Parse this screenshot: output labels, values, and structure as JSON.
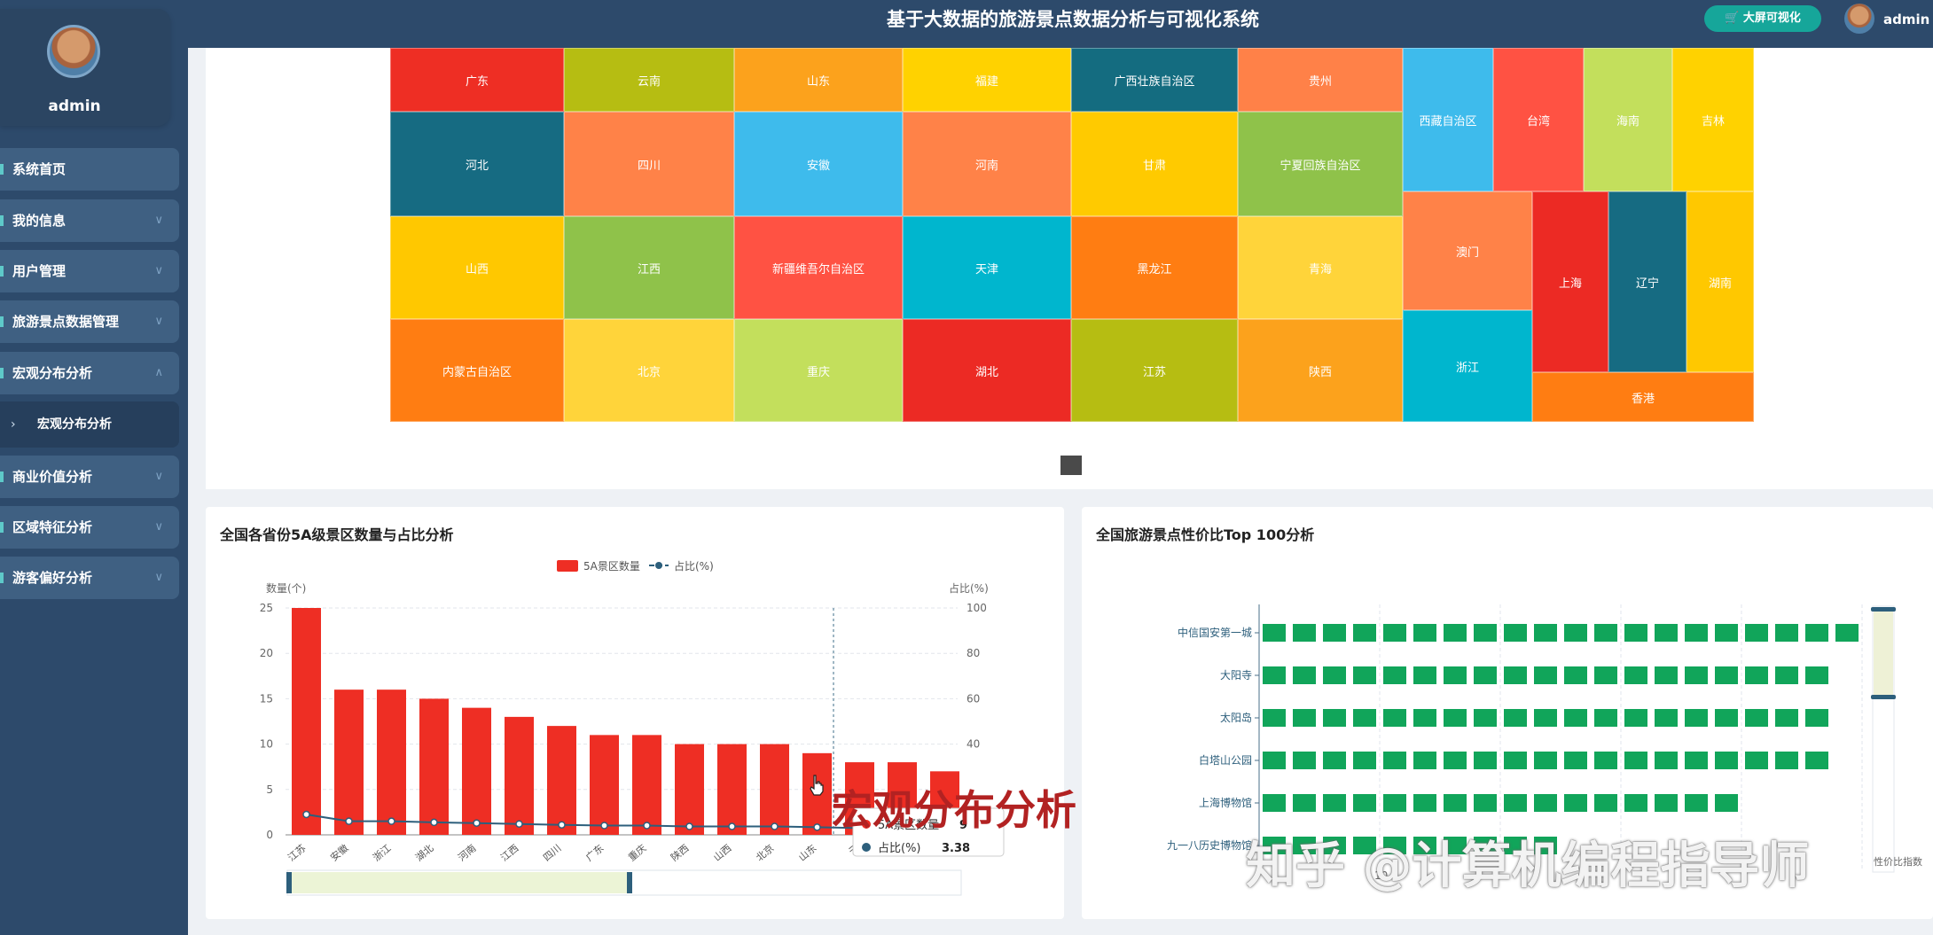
{
  "header": {
    "title": "基于大数据的旅游景点数据分析与可视化系统",
    "big_screen_label": "大屏可视化",
    "user": "admin"
  },
  "sidebar": {
    "user": "admin",
    "items": [
      {
        "label": "系统首页"
      },
      {
        "label": "我的信息",
        "chevron": "∨"
      },
      {
        "label": "用户管理",
        "chevron": "∨"
      },
      {
        "label": "旅游景点数据管理",
        "chevron": "∨"
      },
      {
        "label": "宏观分布分析",
        "chevron": "∧"
      },
      {
        "label": "商业价值分析",
        "chevron": "∨"
      },
      {
        "label": "区域特征分析",
        "chevron": "∨"
      },
      {
        "label": "游客偏好分析",
        "chevron": "∨"
      }
    ],
    "sub_item": {
      "arrow": "›",
      "label": "宏观分布分析"
    }
  },
  "treemap": {
    "cells": [
      {
        "name": "广东",
        "color": "#ee2e24"
      },
      {
        "name": "云南",
        "color": "#b6bd12"
      },
      {
        "name": "山东",
        "color": "#fca21c"
      },
      {
        "name": "福建",
        "color": "#ffd200"
      },
      {
        "name": "广西壮族自治区",
        "color": "#146c80"
      },
      {
        "name": "贵州",
        "color": "#ff8148"
      },
      {
        "name": "河北",
        "color": "#166b82"
      },
      {
        "name": "四川",
        "color": "#ff8248"
      },
      {
        "name": "安徽",
        "color": "#3ebbec"
      },
      {
        "name": "河南",
        "color": "#ff8248"
      },
      {
        "name": "甘肃",
        "color": "#ffca00"
      },
      {
        "name": "宁夏回族自治区",
        "color": "#8fc24a"
      },
      {
        "name": "山西",
        "color": "#ffc800"
      },
      {
        "name": "江西",
        "color": "#8fc24a"
      },
      {
        "name": "新疆维吾尔自治区",
        "color": "#ff5243"
      },
      {
        "name": "天津",
        "color": "#00b6ce"
      },
      {
        "name": "黑龙江",
        "color": "#ff7d12"
      },
      {
        "name": "青海",
        "color": "#ffd43a"
      },
      {
        "name": "内蒙古自治区",
        "color": "#ff7d12"
      },
      {
        "name": "北京",
        "color": "#ffd43a"
      },
      {
        "name": "重庆",
        "color": "#c3df5c"
      },
      {
        "name": "湖北",
        "color": "#ec2a24"
      },
      {
        "name": "江苏",
        "color": "#b6bd12"
      },
      {
        "name": "陕西",
        "color": "#fca21c"
      },
      {
        "name": "西藏自治区",
        "color": "#3ebbec"
      },
      {
        "name": "台湾",
        "color": "#ff5243"
      },
      {
        "name": "海南",
        "color": "#c3df5c"
      },
      {
        "name": "吉林",
        "color": "#ffd200"
      },
      {
        "name": "澳门",
        "color": "#ff8248"
      },
      {
        "name": "上海",
        "color": "#ec2a24"
      },
      {
        "name": "辽宁",
        "color": "#166b82"
      },
      {
        "name": "湖南",
        "color": "#ffc800"
      },
      {
        "name": "浙江",
        "color": "#00b6ce"
      },
      {
        "name": "香港",
        "color": "#ff7d12"
      }
    ]
  },
  "chart_bar": {
    "title": "全国各省份5A级景区数量与占比分析",
    "legend": {
      "bar": "5A景区数量",
      "line": "占比(%)"
    },
    "ylabel_left": "数量(个)",
    "ylabel_right": "占比(%)",
    "tooltip": {
      "bar_label": "5A景区数量",
      "bar_value": "9",
      "line_label": "占比(%)",
      "line_value": "3.38"
    }
  },
  "chart_hbar": {
    "title": "全国旅游景点性价比Top 100分析",
    "x_tick_visible": "10",
    "xlabel_partial": "性价比指数"
  },
  "chart_data": [
    {
      "type": "bar",
      "title": "全国各省份5A级景区数量与占比分析",
      "categories": [
        "江苏",
        "安徽",
        "浙江",
        "湖北",
        "河南",
        "江西",
        "四川",
        "广东",
        "重庆",
        "陕西",
        "山西",
        "北京",
        "山东",
        "云",
        "",
        ""
      ],
      "series": [
        {
          "name": "5A景区数量",
          "values": [
            25,
            16,
            16,
            15,
            14,
            13,
            12,
            11,
            11,
            10,
            10,
            10,
            9,
            8,
            8,
            7
          ]
        },
        {
          "name": "占比(%)",
          "values": [
            9.0,
            6.0,
            6.0,
            5.5,
            5.2,
            4.8,
            4.4,
            4.1,
            4.1,
            3.7,
            3.7,
            3.7,
            3.38,
            3.0,
            3.0,
            2.6
          ]
        }
      ],
      "ylim": [
        0,
        25
      ],
      "y2lim": [
        0,
        100
      ],
      "yticks": [
        0,
        5,
        10,
        15,
        20,
        25
      ],
      "y2ticks": [
        40,
        60,
        80,
        100
      ],
      "xlabel": "",
      "ylabel": "数量(个)",
      "y2label": "占比(%)",
      "legend_position": "top-center",
      "grid": true
    },
    {
      "type": "bar",
      "orientation": "horizontal",
      "title": "全国旅游景点性价比Top 100分析",
      "categories": [
        "中信国安第一城",
        "大阳寺",
        "太阳岛",
        "白塔山公园",
        "上海博物馆",
        "九一八历史博物馆"
      ],
      "series": [
        {
          "name": "性价比指数",
          "values": [
            20,
            19,
            19,
            19,
            16,
            10
          ]
        }
      ],
      "xlabel": "性价比指数",
      "grid": true
    }
  ],
  "overlay": {
    "caption": "宏观分布分析",
    "watermark": "知乎 @计算机编程指导师"
  }
}
